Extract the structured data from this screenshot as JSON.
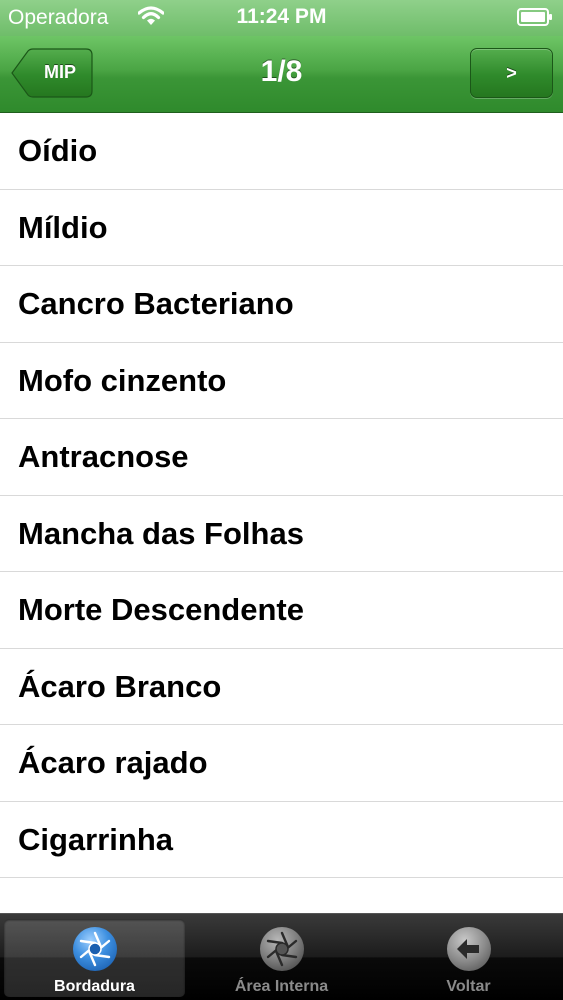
{
  "status_bar": {
    "carrier": "Operadora",
    "time": "11:24 PM"
  },
  "nav_bar": {
    "back_label": "MIP",
    "title": "1/8",
    "next_label": ">"
  },
  "list": {
    "items": [
      {
        "label": "Oídio"
      },
      {
        "label": "Míldio"
      },
      {
        "label": "Cancro Bacteriano"
      },
      {
        "label": "Mofo cinzento"
      },
      {
        "label": "Antracnose"
      },
      {
        "label": "Mancha das Folhas"
      },
      {
        "label": "Morte Descendente"
      },
      {
        "label": "Ácaro Branco"
      },
      {
        "label": "Ácaro rajado"
      },
      {
        "label": "Cigarrinha"
      }
    ]
  },
  "tab_bar": {
    "tabs": [
      {
        "label": "Bordadura",
        "icon": "aperture-icon",
        "selected": true
      },
      {
        "label": "Área Interna",
        "icon": "aperture-icon",
        "selected": false
      },
      {
        "label": "Voltar",
        "icon": "back-arrow-icon",
        "selected": false
      }
    ]
  },
  "colors": {
    "nav_green": "#3b9637",
    "selected_icon_blue": "#3d8fe0"
  }
}
